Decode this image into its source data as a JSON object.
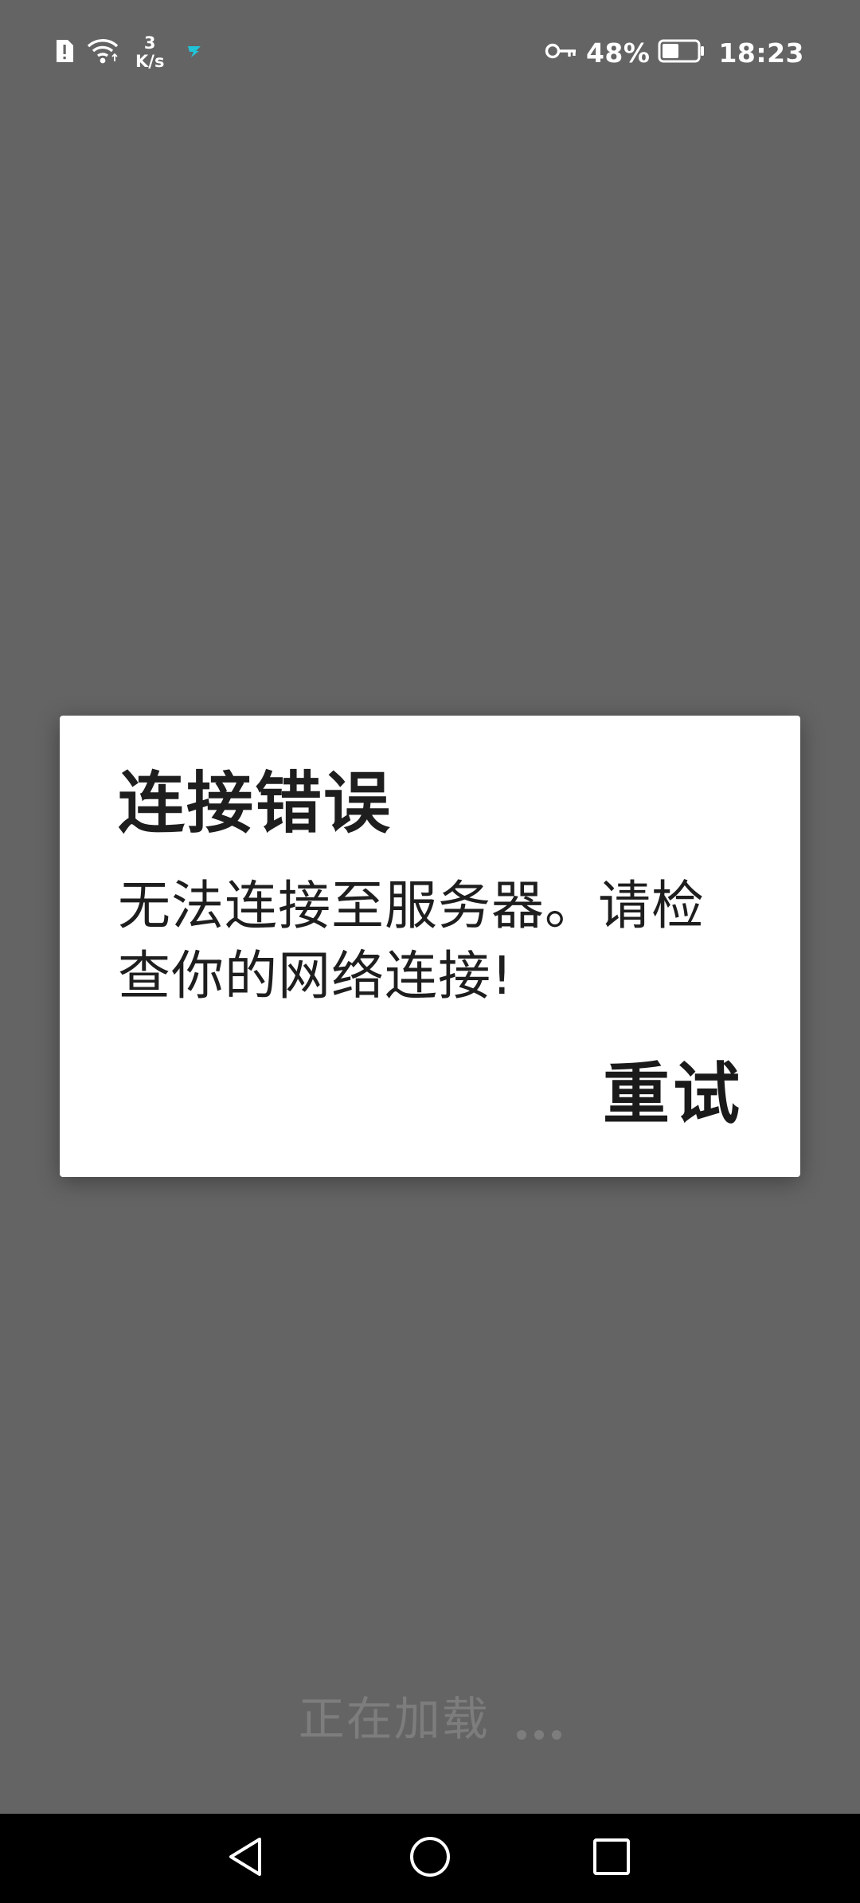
{
  "status_bar": {
    "net_speed_value": "3",
    "net_speed_unit": "K/s",
    "battery_percent": "48%",
    "battery_level": 0.48,
    "time": "18:23",
    "icons": [
      "alert-sim-icon",
      "wifi-icon",
      "app-notification-icon",
      "key-icon",
      "battery-icon"
    ]
  },
  "dialog": {
    "title": "连接错误",
    "message": "无法连接至服务器。请检查你的网络连接!",
    "retry_label": "重试"
  },
  "loading": {
    "text": "正在加载"
  },
  "nav_bar": {
    "icons": [
      "back-icon",
      "home-icon",
      "recents-icon"
    ]
  },
  "colors": {
    "background": "#646464",
    "dialog": "#ffffff",
    "nav_bar": "#000000",
    "loading_text": "#7d7d7d",
    "notification_accent": "#20c4d8"
  }
}
